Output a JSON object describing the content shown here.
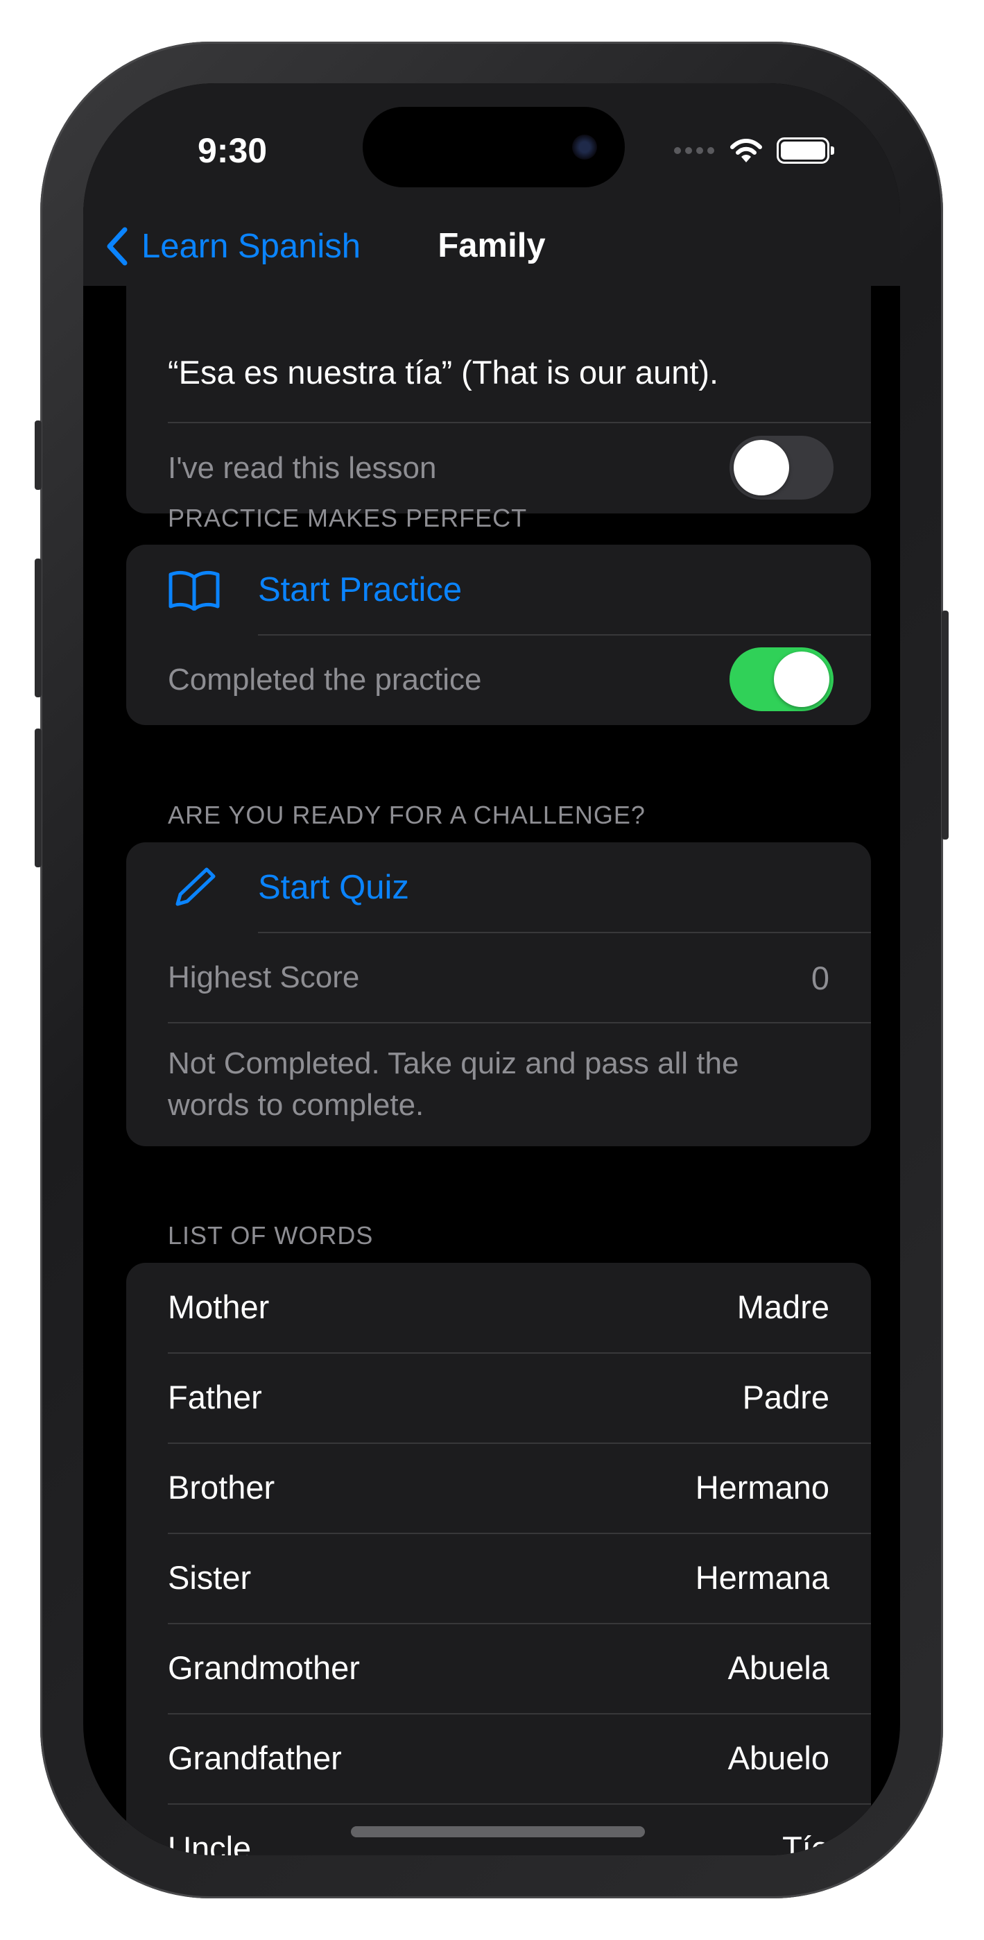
{
  "status_bar": {
    "time": "9:30"
  },
  "nav": {
    "back_label": "Learn Spanish",
    "title": "Family"
  },
  "lesson_card": {
    "example_text": "“Esa es nuestra tía” (That is our aunt).",
    "read_label": "I've read this lesson",
    "read_toggle": "off"
  },
  "practice": {
    "header": "PRACTICE MAKES PERFECT",
    "start_label": "Start Practice",
    "completed_label": "Completed the practice",
    "completed_toggle": "on",
    "icon": "book-icon"
  },
  "quiz": {
    "header": "ARE YOU READY FOR A CHALLENGE?",
    "start_label": "Start Quiz",
    "icon": "pencil-icon",
    "highest_score_label": "Highest Score",
    "highest_score_value": "0",
    "status_text": "Not Completed. Take quiz and pass all the words to complete."
  },
  "words": {
    "header": "LIST OF WORDS",
    "items": [
      {
        "en": "Mother",
        "es": "Madre"
      },
      {
        "en": "Father",
        "es": "Padre"
      },
      {
        "en": "Brother",
        "es": "Hermano"
      },
      {
        "en": "Sister",
        "es": "Hermana"
      },
      {
        "en": "Grandmother",
        "es": "Abuela"
      },
      {
        "en": "Grandfather",
        "es": "Abuelo"
      },
      {
        "en": "Uncle",
        "es": "Tío"
      }
    ]
  },
  "colors": {
    "accent": "#0a84ff",
    "toggle_on": "#30d158",
    "card_bg": "#1c1c1e",
    "background": "#000000"
  }
}
